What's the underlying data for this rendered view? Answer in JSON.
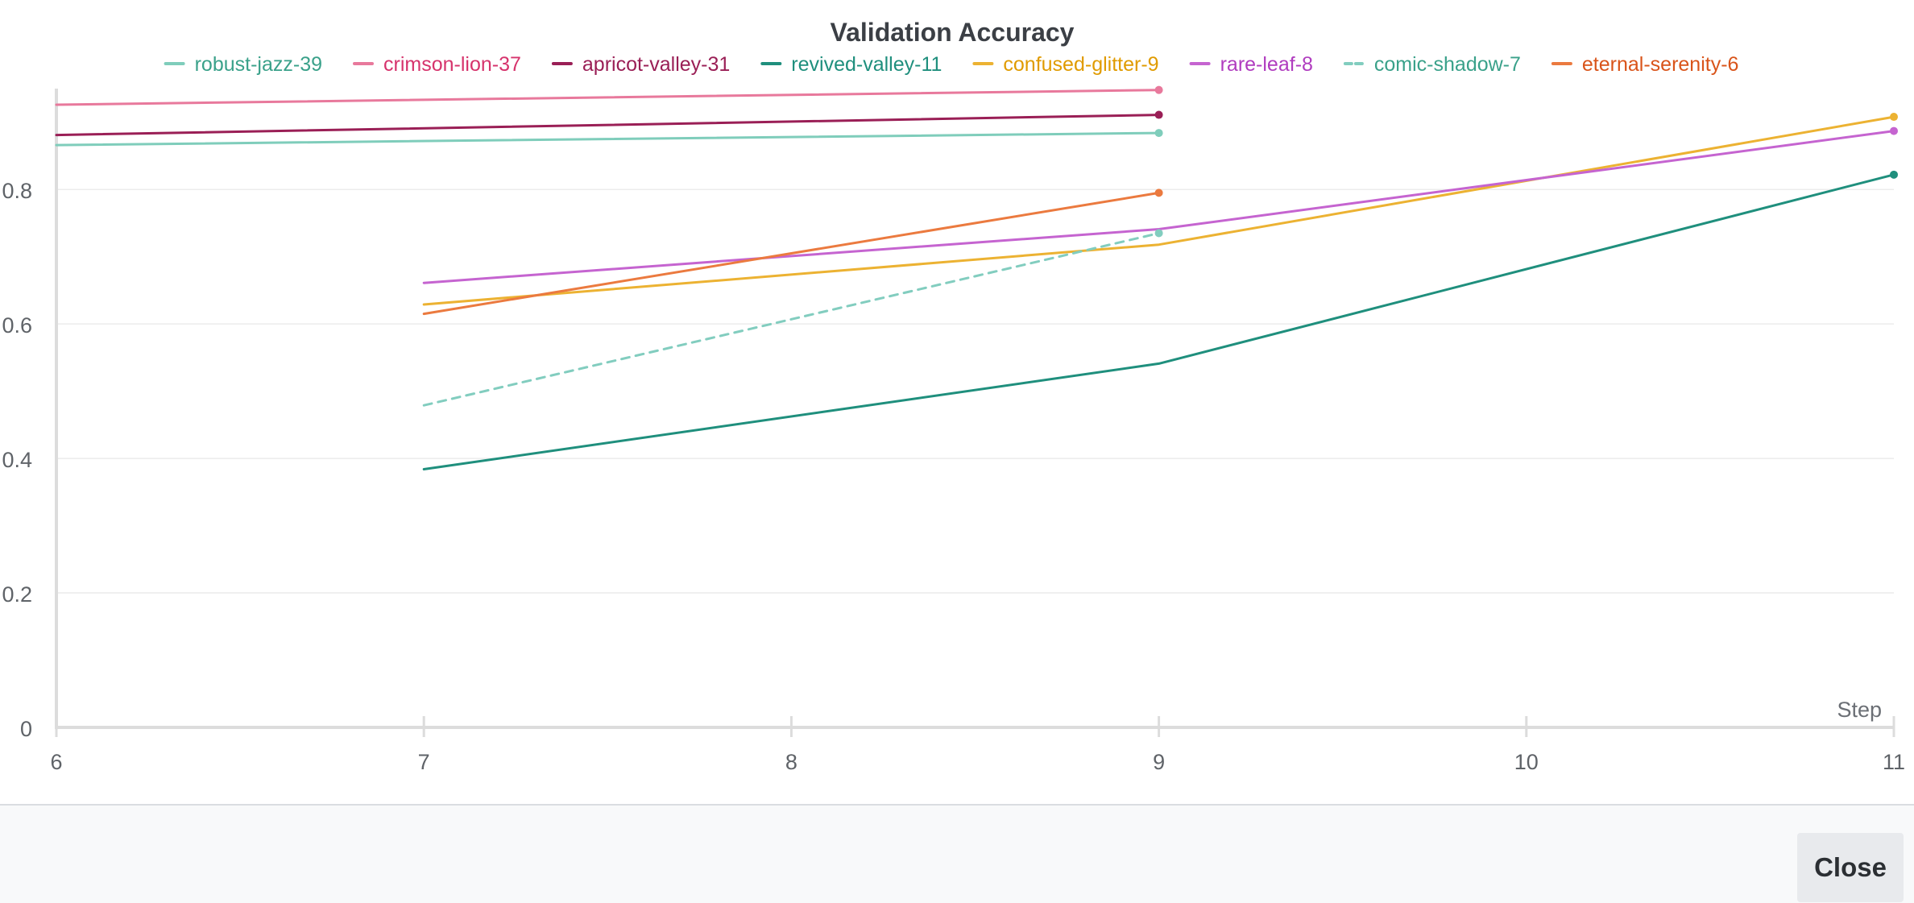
{
  "chart_data": {
    "type": "line",
    "title": "Validation Accuracy",
    "xlabel": "Step",
    "ylabel": "",
    "xlim": [
      6,
      11
    ],
    "ylim": [
      0,
      0.95
    ],
    "x_ticks": [
      6,
      7,
      8,
      9,
      10,
      11
    ],
    "x_tick_labels": [
      "6",
      "7",
      "8",
      "9",
      "10",
      "11"
    ],
    "y_ticks": [
      0,
      0.2,
      0.4,
      0.6,
      0.8
    ],
    "y_tick_labels": [
      "0",
      "0.2",
      "0.4",
      "0.6",
      "0.8"
    ],
    "grid": true,
    "legend_position": "top",
    "series": [
      {
        "name": "robust-jazz-39",
        "color": "#7fcdbb",
        "label_color": "#3aa18a",
        "dashed": false,
        "x": [
          6,
          9
        ],
        "y": [
          0.866,
          0.884
        ]
      },
      {
        "name": "crimson-lion-37",
        "color": "#e8799c",
        "label_color": "#d6336c",
        "dashed": false,
        "x": [
          6,
          9
        ],
        "y": [
          0.926,
          0.948
        ]
      },
      {
        "name": "apricot-valley-31",
        "color": "#9a1f56",
        "label_color": "#9a1f56",
        "dashed": false,
        "x": [
          6,
          9
        ],
        "y": [
          0.881,
          0.911
        ]
      },
      {
        "name": "revived-valley-11",
        "color": "#1f8f7d",
        "label_color": "#1f8f7d",
        "dashed": false,
        "x": [
          7,
          9,
          11
        ],
        "y": [
          0.384,
          0.541,
          0.822
        ]
      },
      {
        "name": "confused-glitter-9",
        "color": "#ecb232",
        "label_color": "#e09b00",
        "dashed": false,
        "x": [
          7,
          9,
          11
        ],
        "y": [
          0.629,
          0.718,
          0.908
        ]
      },
      {
        "name": "rare-leaf-8",
        "color": "#c564d0",
        "label_color": "#b03cbf",
        "dashed": false,
        "x": [
          7,
          9,
          11
        ],
        "y": [
          0.661,
          0.741,
          0.887
        ]
      },
      {
        "name": "comic-shadow-7",
        "color": "#82cdbf",
        "label_color": "#3aa18a",
        "dashed": true,
        "x": [
          7,
          9
        ],
        "y": [
          0.479,
          0.735
        ]
      },
      {
        "name": "eternal-serenity-6",
        "color": "#eb7a3f",
        "label_color": "#d9541a",
        "dashed": false,
        "x": [
          7,
          9
        ],
        "y": [
          0.615,
          0.795
        ]
      }
    ]
  },
  "footer": {
    "close_label": "Close"
  }
}
